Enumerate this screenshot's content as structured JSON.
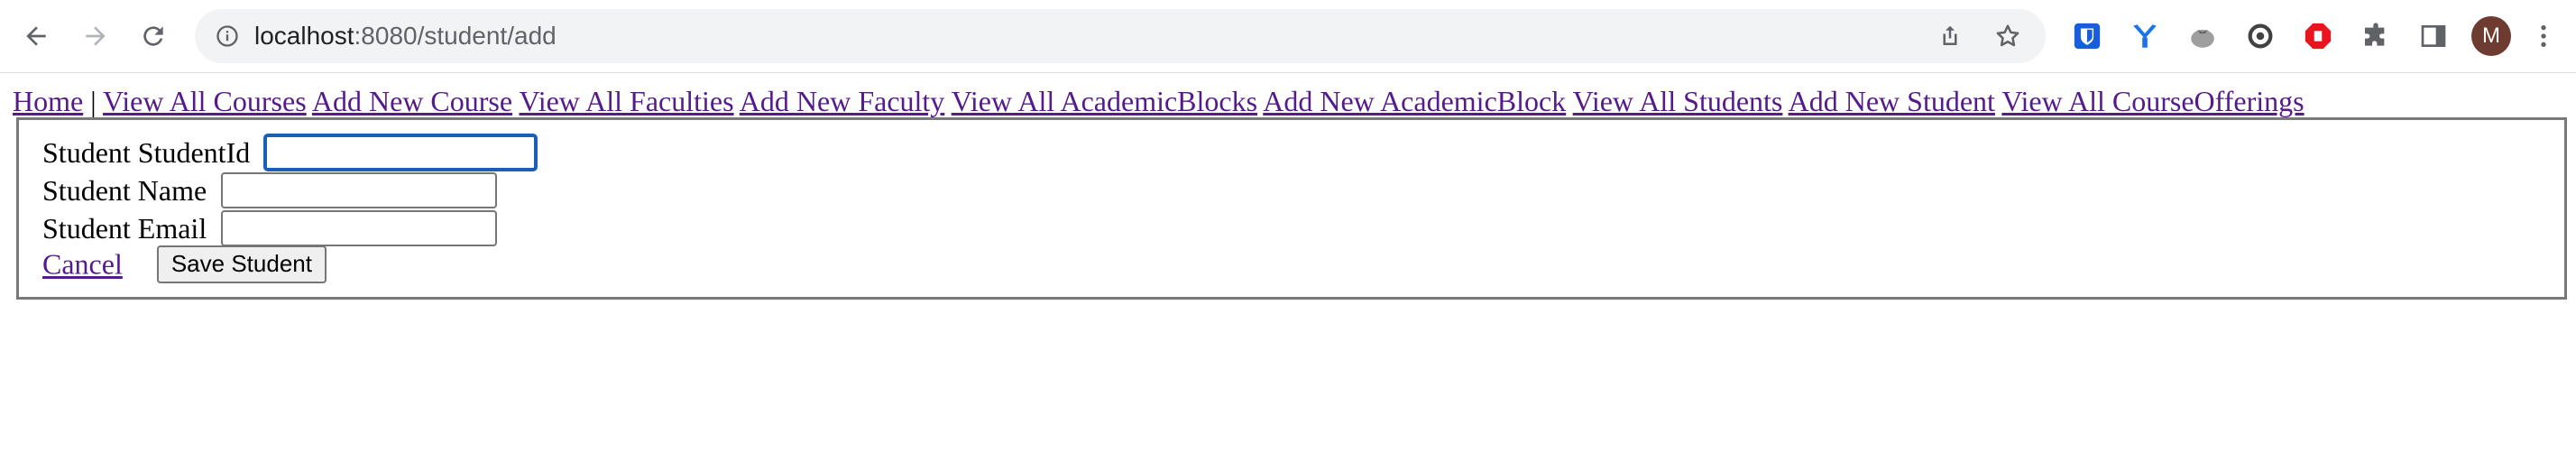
{
  "browser": {
    "url_host": "localhost",
    "url_path": ":8080/student/add",
    "avatar_initial": "M"
  },
  "nav": {
    "home": "Home",
    "separator": "|",
    "links": [
      "View All Courses",
      "Add New Course",
      "View All Faculties",
      "Add New Faculty",
      "View All AcademicBlocks",
      "Add New AcademicBlock",
      "View All Students",
      "Add New Student",
      "View All CourseOfferings"
    ]
  },
  "form": {
    "student_id_label": "Student StudentId",
    "student_id_value": "",
    "student_name_label": "Student Name",
    "student_name_value": "",
    "student_email_label": "Student Email",
    "student_email_value": "",
    "cancel_label": "Cancel",
    "save_label": "Save Student"
  },
  "colors": {
    "visited_link": "#551a8b",
    "focus_ring": "#1a5fb4",
    "form_border": "#7a7a7a"
  }
}
